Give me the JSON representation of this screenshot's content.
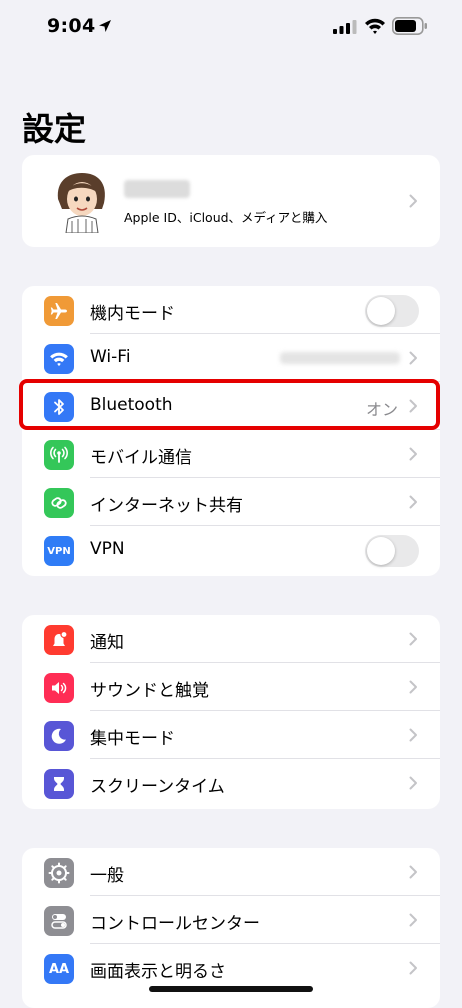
{
  "status_bar": {
    "time": "9:04"
  },
  "page_title": "設定",
  "profile": {
    "subtitle": "Apple ID、iCloud、メディアと購入"
  },
  "network": {
    "airplane": {
      "label": "機内モード",
      "toggle": "off"
    },
    "wifi": {
      "label": "Wi-Fi"
    },
    "bluetooth": {
      "label": "Bluetooth",
      "value": "オン"
    },
    "cellular": {
      "label": "モバイル通信"
    },
    "hotspot": {
      "label": "インターネット共有"
    },
    "vpn": {
      "label": "VPN",
      "icon_text": "VPN",
      "toggle": "off"
    }
  },
  "notifications_group": {
    "notifications": {
      "label": "通知"
    },
    "sounds": {
      "label": "サウンドと触覚"
    },
    "focus": {
      "label": "集中モード"
    },
    "screen_time": {
      "label": "スクリーンタイム"
    }
  },
  "general_group": {
    "general": {
      "label": "一般"
    },
    "control_center": {
      "label": "コントロールセンター"
    },
    "display": {
      "label": "画面表示と明るさ",
      "icon_text": "AA"
    }
  },
  "colors": {
    "airplane": "#f09a37",
    "wifi": "#3478f6",
    "bluetooth": "#3478f6",
    "cellular": "#34c759",
    "hotspot": "#34c759",
    "vpn": "#2f7cf6",
    "notifications": "#ff3b30",
    "sounds": "#ff2d55",
    "focus": "#5856d6",
    "screen_time": "#5856d6",
    "general": "#8e8e93",
    "control_center": "#8e8e93",
    "display": "#3478f6",
    "highlight": "#e50000"
  }
}
